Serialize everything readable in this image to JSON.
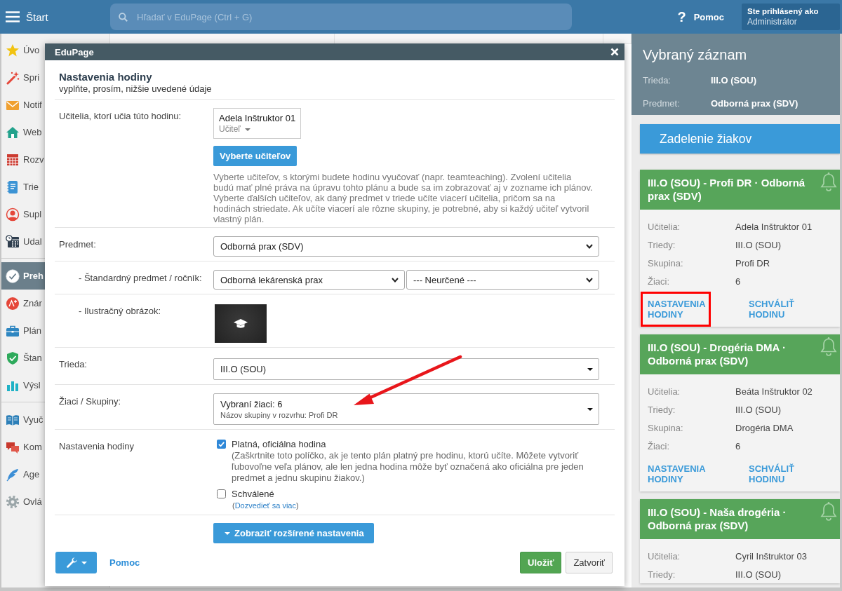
{
  "topbar": {
    "menu_label": "Štart",
    "search": {
      "placeholder": "Hľadať v EduPage (Ctrl + G)"
    },
    "help": {
      "glyph": "?",
      "label": "Pomoc"
    },
    "user": {
      "caption": "Ste prihlásený ako",
      "name": "Administrátor"
    }
  },
  "sidebar": {
    "groups": [
      {
        "items": [
          {
            "label": "Úvo",
            "selected": false
          },
          {
            "label": "Spri",
            "selected": false
          },
          {
            "label": "Notif",
            "selected": false
          },
          {
            "label": "Web",
            "selected": false
          },
          {
            "label": "Rozv",
            "selected": false
          },
          {
            "label": "Trie",
            "selected": false
          },
          {
            "label": "Supl",
            "selected": false
          },
          {
            "label": "Udal",
            "selected": false
          }
        ]
      },
      {
        "items": [
          {
            "label": "Preh",
            "selected": true
          },
          {
            "label": "Znár",
            "selected": false
          },
          {
            "label": "Plán",
            "selected": false
          },
          {
            "label": "Štan",
            "selected": false
          },
          {
            "label": "Výsl",
            "selected": false
          }
        ]
      },
      {
        "items": [
          {
            "label": "Vyuč",
            "selected": false
          },
          {
            "label": "Kom",
            "selected": false
          },
          {
            "label": "Age",
            "selected": false
          },
          {
            "label": "Ovlá",
            "selected": false
          }
        ]
      }
    ]
  },
  "modal": {
    "title": "EduPage",
    "heading": "Nastavenia hodiny",
    "subheading": "vyplňte, prosím, nižšie uvedené údaje",
    "rows": [
      {
        "kind": "teachers",
        "label": "Učitelia, ktorí učia túto hodinu:",
        "teachers": [
          {
            "name": "Adela Inštruktor 01",
            "role": "Učiteľ"
          }
        ],
        "button": "Vyberte učiteľov",
        "help": "Vyberte učiteľov, s ktorými budete hodinu vyučovať (napr. teamteaching). Zvolení učitelia\nbudú mať plné práva na úpravu tohto plánu a bude sa im zobrazovať aj v zozname ich plánov.\nVyberte ďalších učiteľov, ak daný predmet v triede učíte viacerí učitelia, pričom sa na\nhodinách striedate. Ak učíte viacerí ale rôzne skupiny, je potrebné, aby si každý učiteľ vytvoril\nvlastný plán."
      },
      {
        "kind": "select",
        "label": "Predmet:",
        "selects": [
          {
            "value": "Odborná prax (SDV)"
          }
        ],
        "children": [
          {
            "kind": "select",
            "label": "- Štandardný predmet / ročník:",
            "selects": [
              {
                "value": "Odborná lekárenská prax"
              },
              {
                "value": "--- Neurčené ---"
              }
            ]
          },
          {
            "kind": "image",
            "label": "- Ilustračný obrázok:"
          }
        ]
      },
      {
        "kind": "dropdown",
        "label": "Trieda:",
        "value": "III.O (SOU)"
      },
      {
        "kind": "dropdown",
        "label": "Žiaci / Skupiny:",
        "value": "Vybraní žiaci: 6",
        "note": "Názov skupiny v rozvrhu: Profi DR"
      },
      {
        "kind": "checks",
        "label": "Nastavenia hodiny",
        "options": [
          {
            "label": "Platná, oficiálna hodina",
            "checked": true,
            "note": {
              "text": "(Zaškrtnite toto políčko, ak je tento plán platný pre hodinu, ktorú učíte. Môžete vytvoriť ľubovoľne veľa plánov, ale len jedna hodina môže byť označená ako oficiálna pre jeden predmet a jednu skupinu žiakov.)"
            }
          },
          {
            "label": "Schválené",
            "checked": false,
            "note": {
              "before": "(",
              "link": "Dozvedieť sa viac",
              "after": ")"
            }
          }
        ]
      }
    ],
    "expand_button": "Zobraziť rozšírené nastavenia",
    "footer": {
      "help_link": "Pomoc",
      "buttons": [
        {
          "label": "Uložiť",
          "kind": "primary"
        },
        {
          "label": "Zatvoriť",
          "kind": "secondary"
        }
      ]
    },
    "annotations": [
      {
        "kind": "arrow"
      }
    ]
  },
  "record_panel": {
    "title": "Vybraný záznam",
    "fields": [
      {
        "label": "Trieda:",
        "value": "III.O (SOU)"
      },
      {
        "label": "Predmet:",
        "value": "Odborná prax (SDV)"
      }
    ],
    "assign_button": "Zadelenie žiakov",
    "cards": [
      {
        "title": "III.O (SOU) - Profi DR · Odborná prax (SDV)",
        "fields": [
          {
            "label": "Učitelia:",
            "value": "Adela Inštruktor 01"
          },
          {
            "label": "Triedy:",
            "value": "III.O (SOU)"
          },
          {
            "label": "Skupina:",
            "value": "Profi DR"
          },
          {
            "label": "Žiaci:",
            "value": "6"
          }
        ],
        "actions": [
          {
            "label": "NASTAVENIA HODINY",
            "highlighted": true
          },
          {
            "label": "SCHVÁLIŤ HODINU",
            "highlighted": false
          }
        ]
      },
      {
        "title": "III.O (SOU) - Drogéria DMA · Odborná prax (SDV)",
        "fields": [
          {
            "label": "Učitelia:",
            "value": "Beáta Inštruktor 02"
          },
          {
            "label": "Triedy:",
            "value": "III.O (SOU)"
          },
          {
            "label": "Skupina:",
            "value": "Drogéria DMA"
          },
          {
            "label": "Žiaci:",
            "value": "6"
          }
        ],
        "actions": [
          {
            "label": "NASTAVENIA HODINY",
            "highlighted": false
          },
          {
            "label": "SCHVÁLIŤ HODINU",
            "highlighted": false
          }
        ]
      },
      {
        "title": "III.O (SOU) - Naša drogéria · Odborná prax (SDV)",
        "fields": [
          {
            "label": "Učitelia:",
            "value": "Cyril Inštruktor 03"
          },
          {
            "label": "Triedy:",
            "value": "III.O (SOU)"
          }
        ]
      }
    ]
  }
}
